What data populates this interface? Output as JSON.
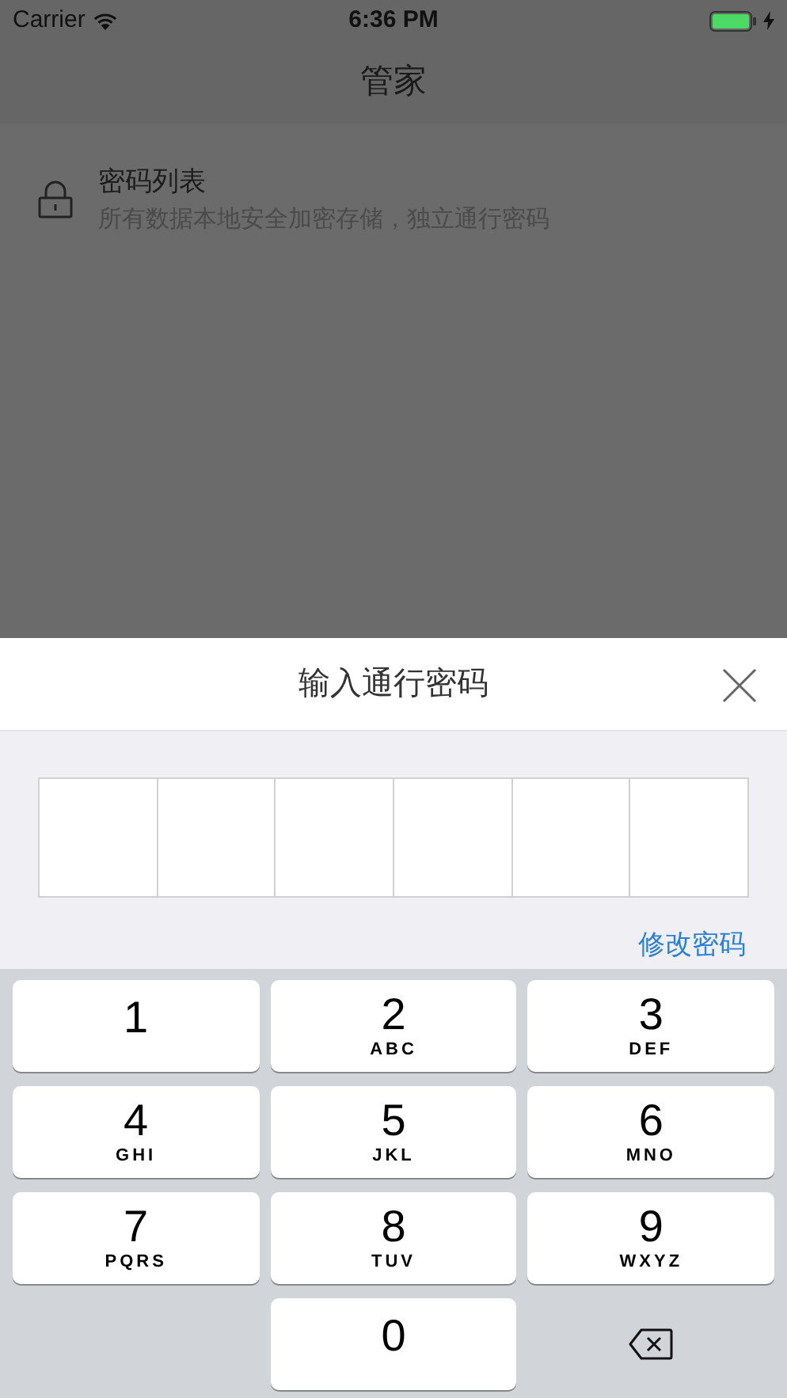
{
  "status_bar": {
    "carrier": "Carrier",
    "time": "6:36 PM"
  },
  "nav": {
    "title": "管家"
  },
  "list": [
    {
      "title": "密码列表",
      "subtitle": "所有数据本地安全加密存储，独立通行密码"
    }
  ],
  "sheet": {
    "title": "输入通行密码",
    "boxes": [
      {
        "filled": false
      },
      {
        "filled": false
      },
      {
        "filled": false
      },
      {
        "filled": false
      },
      {
        "filled": false
      },
      {
        "filled": false
      }
    ],
    "link": "修改密码"
  },
  "keypad": [
    {
      "kind": "digit",
      "digit": "1"
    },
    {
      "kind": "digit",
      "digit": "2",
      "letters": "ABC"
    },
    {
      "kind": "digit",
      "digit": "3",
      "letters": "DEF"
    },
    {
      "kind": "digit",
      "digit": "4",
      "letters": "GHI"
    },
    {
      "kind": "digit",
      "digit": "5",
      "letters": "JKL"
    },
    {
      "kind": "digit",
      "digit": "6",
      "letters": "MNO"
    },
    {
      "kind": "digit",
      "digit": "7",
      "letters": "PQRS"
    },
    {
      "kind": "digit",
      "digit": "8",
      "letters": "TUV"
    },
    {
      "kind": "digit",
      "digit": "9",
      "letters": "WXYZ"
    },
    {
      "kind": "blank"
    },
    {
      "kind": "digit",
      "digit": "0"
    },
    {
      "kind": "delete"
    }
  ]
}
